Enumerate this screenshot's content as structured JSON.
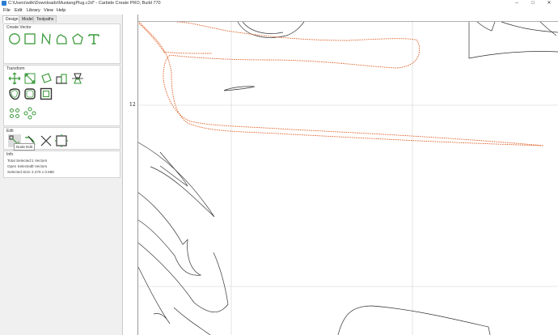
{
  "window": {
    "title": "C:\\Users\\wilk\\Downloads\\MustangPlug.c2d* - Carbide Create PRO, Build 770",
    "controls": {
      "minimize": "–",
      "maximize": "□",
      "close": "✕"
    }
  },
  "menu": [
    "File",
    "Edit",
    "Library",
    "View",
    "Help"
  ],
  "tabs": [
    "Design",
    "Model",
    "Toolpaths"
  ],
  "sections": {
    "create_vector": "Create Vector",
    "transform": "Transform",
    "edit": "Edit",
    "info": "Info"
  },
  "tools": {
    "create_vector": [
      "circle",
      "rectangle",
      "polyline",
      "curve",
      "polygon",
      "text"
    ],
    "transform_row1": [
      "move",
      "scale",
      "rotate",
      "align",
      "mirror"
    ],
    "transform_row2": [
      "offset",
      "round-corners",
      "boolean"
    ],
    "transform_row3": [
      "array-linear",
      "array-circular"
    ],
    "edit": [
      "node-edit",
      "trim",
      "cut",
      "join"
    ]
  },
  "tooltip": "Node Edit",
  "info": {
    "total_selected": "Total Selected:",
    "total_selected_value": "1 Vectors",
    "open_selected": "Open Selected:",
    "open_selected_value": "0 Vectors",
    "selected_size": "Selected Size:",
    "selected_size_value": "2.476 x 0.688"
  },
  "ruler": {
    "left_label": "12"
  },
  "colors": {
    "selected_vector": "#e0622a",
    "vector": "#333333",
    "accent_green": "#3a9a3a",
    "grid": "#d0d0d0",
    "origin_marker": "#cc2222"
  }
}
